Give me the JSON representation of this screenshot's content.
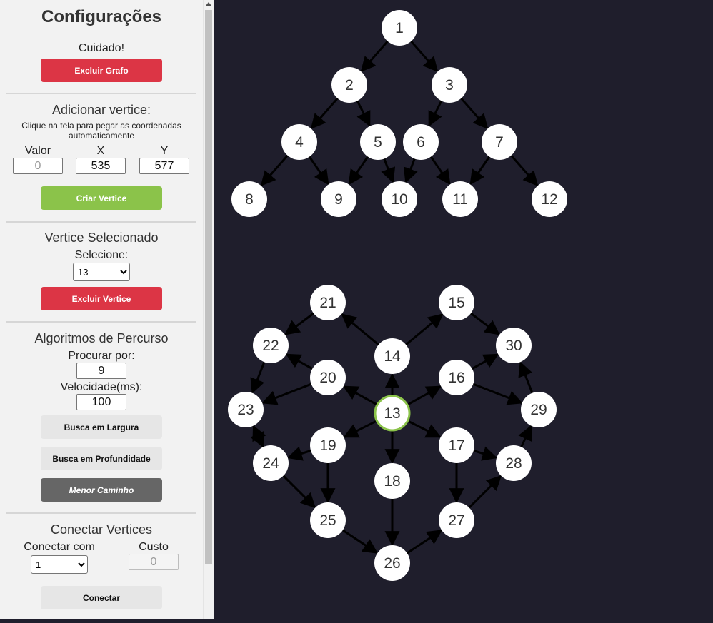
{
  "sidebar": {
    "title": "Configurações",
    "warning": "Cuidado!",
    "delete_graph_label": "Excluir Grafo",
    "add_vertex": {
      "heading": "Adicionar vertice:",
      "hint": "Clique na tela para pegar as coordenadas automaticamente",
      "value_label": "Valor",
      "x_label": "X",
      "y_label": "Y",
      "value_placeholder": "0",
      "x_value": "535",
      "y_value": "577",
      "create_label": "Criar Vertice"
    },
    "selected_vertex": {
      "heading": "Vertice Selecionado",
      "select_label": "Selecione:",
      "selected": "13",
      "delete_label": "Excluir Vertice"
    },
    "algorithms": {
      "heading": "Algoritmos de Percurso",
      "search_label": "Procurar por:",
      "search_value": "9",
      "speed_label": "Velocidade(ms):",
      "speed_value": "100",
      "bfs_label": "Busca em Largura",
      "dfs_label": "Busca em Profundidade",
      "shortest_label": "Menor Caminho"
    },
    "connect": {
      "heading": "Conectar Vertices",
      "connect_with_label": "Conectar com",
      "connect_with_value": "1",
      "cost_label": "Custo",
      "cost_placeholder": "0",
      "connect_label": "Conectar"
    }
  },
  "graph": {
    "background": "#1f1e2c",
    "node_color": "#ffffff",
    "edge_color": "#000000",
    "selected_outline": "#8bc34a",
    "selected_node": "13",
    "nodes": [
      "1",
      "2",
      "3",
      "4",
      "5",
      "6",
      "7",
      "8",
      "9",
      "10",
      "11",
      "12",
      "13",
      "14",
      "15",
      "16",
      "17",
      "18",
      "19",
      "20",
      "21",
      "22",
      "23",
      "24",
      "25",
      "26",
      "27",
      "28",
      "29",
      "30"
    ],
    "edges": [
      [
        "1",
        "2"
      ],
      [
        "1",
        "3"
      ],
      [
        "2",
        "4"
      ],
      [
        "2",
        "5"
      ],
      [
        "3",
        "6"
      ],
      [
        "3",
        "7"
      ],
      [
        "4",
        "8"
      ],
      [
        "4",
        "9"
      ],
      [
        "5",
        "9"
      ],
      [
        "5",
        "10"
      ],
      [
        "6",
        "10"
      ],
      [
        "6",
        "11"
      ],
      [
        "7",
        "11"
      ],
      [
        "7",
        "12"
      ],
      [
        "13",
        "14"
      ],
      [
        "13",
        "16"
      ],
      [
        "13",
        "17"
      ],
      [
        "13",
        "18"
      ],
      [
        "13",
        "19"
      ],
      [
        "13",
        "20"
      ],
      [
        "14",
        "15"
      ],
      [
        "14",
        "21"
      ],
      [
        "15",
        "30"
      ],
      [
        "16",
        "30"
      ],
      [
        "16",
        "29"
      ],
      [
        "17",
        "28"
      ],
      [
        "17",
        "27"
      ],
      [
        "18",
        "26"
      ],
      [
        "19",
        "24"
      ],
      [
        "19",
        "25"
      ],
      [
        "20",
        "22"
      ],
      [
        "20",
        "23"
      ],
      [
        "21",
        "22"
      ],
      [
        "22",
        "23"
      ],
      [
        "23",
        "24"
      ],
      [
        "24",
        "23"
      ],
      [
        "24",
        "25"
      ],
      [
        "25",
        "26"
      ],
      [
        "26",
        "27"
      ],
      [
        "27",
        "28"
      ],
      [
        "28",
        "29"
      ],
      [
        "29",
        "30"
      ]
    ]
  }
}
